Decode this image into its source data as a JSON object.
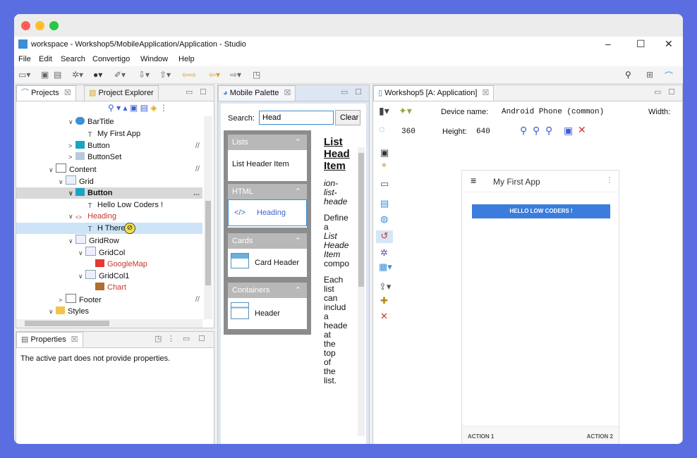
{
  "window": {
    "title": "workspace - Workshop5/MobileApplication/Application - Studio",
    "controls": [
      "–",
      "☐",
      "✕"
    ]
  },
  "menu": [
    "File",
    "Edit",
    "Search",
    "Convertigo",
    "Window",
    "Help"
  ],
  "projects_panel": {
    "tab_projects": "Projects",
    "tab_explorer": "Project Explorer",
    "tree": [
      {
        "label": "BarTitle",
        "depth": 5,
        "exp": "∨",
        "icon": "bartitle-icon",
        "color": "#111",
        "suffix": ""
      },
      {
        "label": "My First App",
        "depth": 6,
        "exp": "",
        "icon": "text-icon",
        "color": "#111",
        "suffix": ""
      },
      {
        "label": "Button",
        "depth": 5,
        "exp": ">",
        "icon": "button-icon",
        "color": "#111",
        "suffix": "//"
      },
      {
        "label": "ButtonSet",
        "depth": 5,
        "exp": ">",
        "icon": "buttonset-icon",
        "color": "#111",
        "suffix": ""
      },
      {
        "label": "Content",
        "depth": 3,
        "exp": "∨",
        "icon": "content-icon",
        "color": "#111",
        "suffix": "//"
      },
      {
        "label": "Grid",
        "depth": 4,
        "exp": "∨",
        "icon": "grid-icon",
        "color": "#111",
        "suffix": ""
      },
      {
        "label": "Button",
        "depth": 5,
        "exp": "∨",
        "icon": "button-icon",
        "color": "#111",
        "suffix": "...",
        "bold": true
      },
      {
        "label": "Hello Low Coders !",
        "depth": 6,
        "exp": "",
        "icon": "text-icon",
        "color": "#111",
        "suffix": ""
      },
      {
        "label": "Heading",
        "depth": 5,
        "exp": "∨",
        "icon": "heading-icon",
        "color": "#c0392b",
        "suffix": ""
      },
      {
        "label": "H   There",
        "depth": 6,
        "exp": "",
        "icon": "text-icon",
        "color": "#111",
        "suffix": "",
        "selected": true
      },
      {
        "label": "GridRow",
        "depth": 5,
        "exp": "∨",
        "icon": "gridrow-icon",
        "color": "#111",
        "suffix": ""
      },
      {
        "label": "GridCol",
        "depth": 6,
        "exp": "∨",
        "icon": "gridcol-icon",
        "color": "#111",
        "suffix": ""
      },
      {
        "label": "GoogleMap",
        "depth": 7,
        "exp": "",
        "icon": "googlemap-icon",
        "color": "#c0392b",
        "suffix": ""
      },
      {
        "label": "GridCol1",
        "depth": 6,
        "exp": "∨",
        "icon": "gridcol-icon",
        "color": "#111",
        "suffix": ""
      },
      {
        "label": "Chart",
        "depth": 7,
        "exp": "",
        "icon": "chart-icon",
        "color": "#c0392b",
        "suffix": ""
      },
      {
        "label": "Footer",
        "depth": 4,
        "exp": ">",
        "icon": "footer-icon",
        "color": "#111",
        "suffix": "//"
      },
      {
        "label": "Styles",
        "depth": 3,
        "exp": "∨",
        "icon": "folder-icon",
        "color": "#111",
        "suffix": ""
      }
    ]
  },
  "properties_panel": {
    "tab": "Properties",
    "message": "The active part does not provide properties."
  },
  "palette_panel": {
    "tab": "Mobile Palette",
    "search_label": "Search:",
    "search_value": "Head",
    "clear_label": "Clear",
    "groups": [
      {
        "title": "Lists",
        "item": "List Header Item",
        "item_icon": ""
      },
      {
        "title": "HTML",
        "item": "Heading",
        "item_icon": "</>"
      },
      {
        "title": "Cards",
        "item": "Card Header",
        "item_icon": "card"
      },
      {
        "title": "Containers",
        "item": "Header",
        "item_icon": "header"
      }
    ],
    "doc_title_lines": [
      "List",
      "Head",
      "Item"
    ],
    "doc_italic_lines": [
      "ion-",
      "list-",
      "heade"
    ],
    "doc_text_lines": [
      "Define",
      "a"
    ],
    "doc_italic2_lines": [
      "List",
      "Heade",
      "Item"
    ],
    "doc_text2_lines": [
      "compo"
    ],
    "doc_text3_lines": [
      "Each",
      "list",
      "can",
      "includ",
      "a",
      "heade",
      "at",
      "the",
      "top",
      "of",
      "the",
      "list."
    ]
  },
  "editor_panel": {
    "tab": "Workshop5 [A: Application]",
    "device_label": "Device name:",
    "device_value": "Android Phone (common)",
    "width_label": "Width:",
    "width_value": "360",
    "height_label": "Height:",
    "height_value": "640"
  },
  "phone": {
    "app_title": "My First App",
    "button_label": "HELLO LOW CODERS !",
    "action1": "ACTION 1",
    "action2": "ACTION 2"
  },
  "colors": {
    "accent": "#3b8fd6",
    "palette_group": "#b8b8b8",
    "phone_button": "#3b7ddd",
    "selection": "#cde3f8",
    "red_label": "#c0392b"
  }
}
